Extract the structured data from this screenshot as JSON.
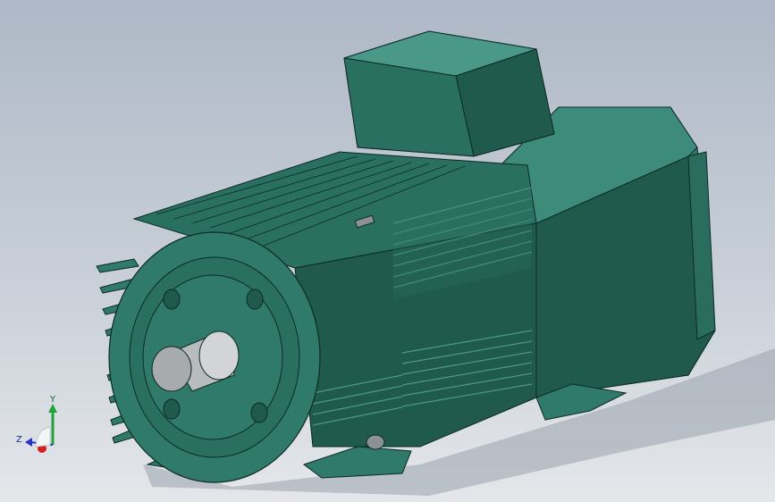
{
  "viewport": {
    "background_top": "#aeb8c6",
    "background_bottom": "#e4e7ea"
  },
  "model": {
    "body_color": "#2f7a6a",
    "body_dark": "#1f5a4c",
    "body_light": "#4a9888",
    "shaft_color": "#b9bcbd",
    "edge_color": "#0d2a24"
  },
  "triad": {
    "y_label": "Y",
    "z_label": "Z",
    "y_color": "#22a33a",
    "x_color": "#d62020",
    "z_color": "#2433c8"
  }
}
